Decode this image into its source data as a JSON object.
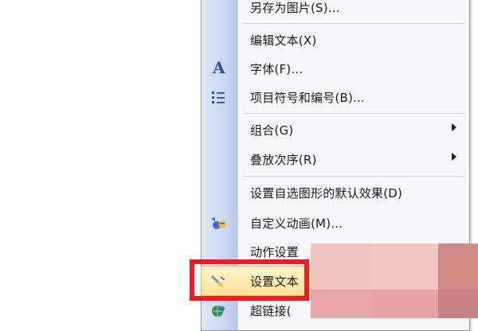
{
  "menu": {
    "items": [
      {
        "label": "另存为图片(S)..."
      },
      {
        "label": "编辑文本(X)"
      },
      {
        "label": "字体(F)..."
      },
      {
        "label": "项目符号和编号(B)..."
      },
      {
        "label": "组合(G)"
      },
      {
        "label": "叠放次序(R)"
      },
      {
        "label": "设置自选图形的默认效果(D)"
      },
      {
        "label": "自定义动画(M)..."
      },
      {
        "label": "动作设置"
      },
      {
        "label": "设置文本"
      },
      {
        "label": "超链接("
      }
    ]
  },
  "colors": {
    "highlight": "#ee1c25",
    "gutter": "#c7d6f0",
    "pixel_blocks": [
      "#f2c4c0",
      "#f3c7bd",
      "#cf8a85",
      "#e8a6a7",
      "#e7a3a2",
      "#c98282"
    ]
  }
}
